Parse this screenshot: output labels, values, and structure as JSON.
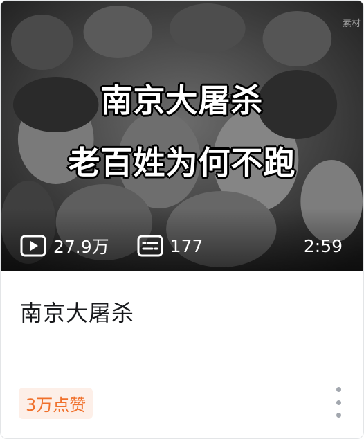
{
  "video": {
    "watermark": "素材",
    "overlay_line1": "南京大屠杀",
    "overlay_line2": "老百姓为何不跑",
    "views": "27.9万",
    "danmaku": "177",
    "duration": "2:59",
    "title": "南京大屠杀",
    "likes_badge": "3万点赞"
  },
  "icons": {
    "views": "play-count-icon",
    "danmaku": "danmaku-icon",
    "more": "more-vertical-icon"
  },
  "colors": {
    "badge_bg": "#fdefe8",
    "badge_text": "#f0702b",
    "title_text": "#18191c",
    "more_dots": "#a2a7ae"
  }
}
